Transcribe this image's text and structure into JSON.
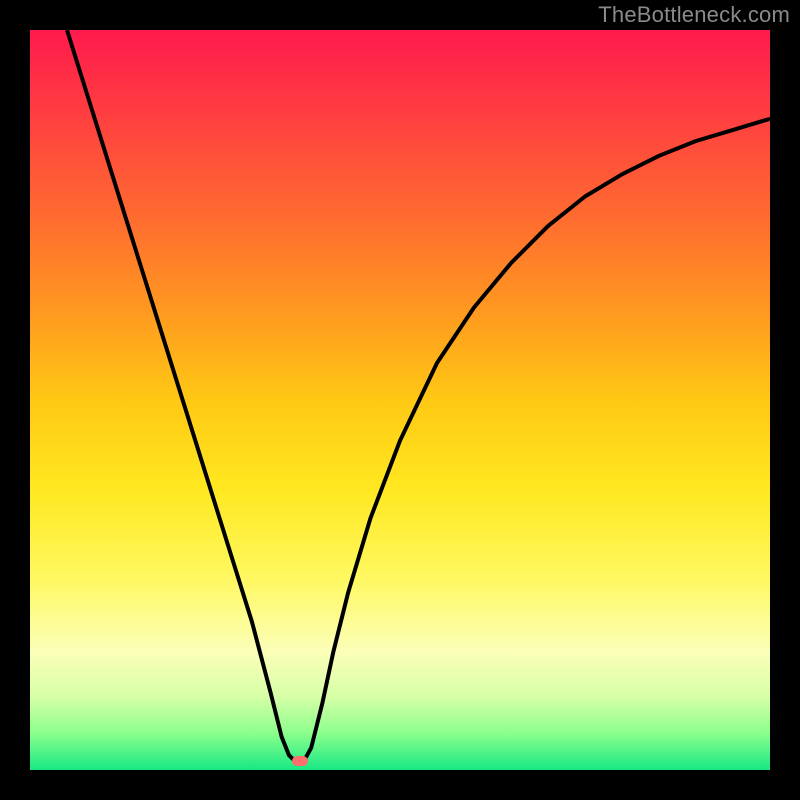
{
  "watermark": "TheBottleneck.com",
  "colors": {
    "curve": "#000000",
    "marker": "#ff6d6d",
    "frame_bg": "#000000",
    "gradient_top": "#ff1a4d",
    "gradient_bottom": "#17e884"
  },
  "chart_data": {
    "type": "line",
    "title": "",
    "xlabel": "",
    "ylabel": "",
    "xlim": [
      0,
      100
    ],
    "ylim": [
      0,
      100
    ],
    "marker": {
      "x": 36.5,
      "y": 1.2
    },
    "curve_points": [
      {
        "x": 5.0,
        "y": 100.0
      },
      {
        "x": 7.5,
        "y": 92.0
      },
      {
        "x": 10.0,
        "y": 84.0
      },
      {
        "x": 12.5,
        "y": 76.0
      },
      {
        "x": 15.0,
        "y": 68.0
      },
      {
        "x": 17.5,
        "y": 60.0
      },
      {
        "x": 20.0,
        "y": 52.0
      },
      {
        "x": 22.5,
        "y": 44.0
      },
      {
        "x": 25.0,
        "y": 36.0
      },
      {
        "x": 27.5,
        "y": 28.0
      },
      {
        "x": 30.0,
        "y": 20.0
      },
      {
        "x": 32.5,
        "y": 10.5
      },
      {
        "x": 34.0,
        "y": 4.5
      },
      {
        "x": 35.0,
        "y": 2.0
      },
      {
        "x": 36.0,
        "y": 1.0
      },
      {
        "x": 37.0,
        "y": 1.2
      },
      {
        "x": 38.0,
        "y": 3.0
      },
      {
        "x": 39.5,
        "y": 9.0
      },
      {
        "x": 41.0,
        "y": 16.0
      },
      {
        "x": 43.0,
        "y": 24.0
      },
      {
        "x": 46.0,
        "y": 34.0
      },
      {
        "x": 50.0,
        "y": 44.5
      },
      {
        "x": 55.0,
        "y": 55.0
      },
      {
        "x": 60.0,
        "y": 62.5
      },
      {
        "x": 65.0,
        "y": 68.5
      },
      {
        "x": 70.0,
        "y": 73.5
      },
      {
        "x": 75.0,
        "y": 77.5
      },
      {
        "x": 80.0,
        "y": 80.5
      },
      {
        "x": 85.0,
        "y": 83.0
      },
      {
        "x": 90.0,
        "y": 85.0
      },
      {
        "x": 95.0,
        "y": 86.5
      },
      {
        "x": 100.0,
        "y": 88.0
      }
    ]
  }
}
